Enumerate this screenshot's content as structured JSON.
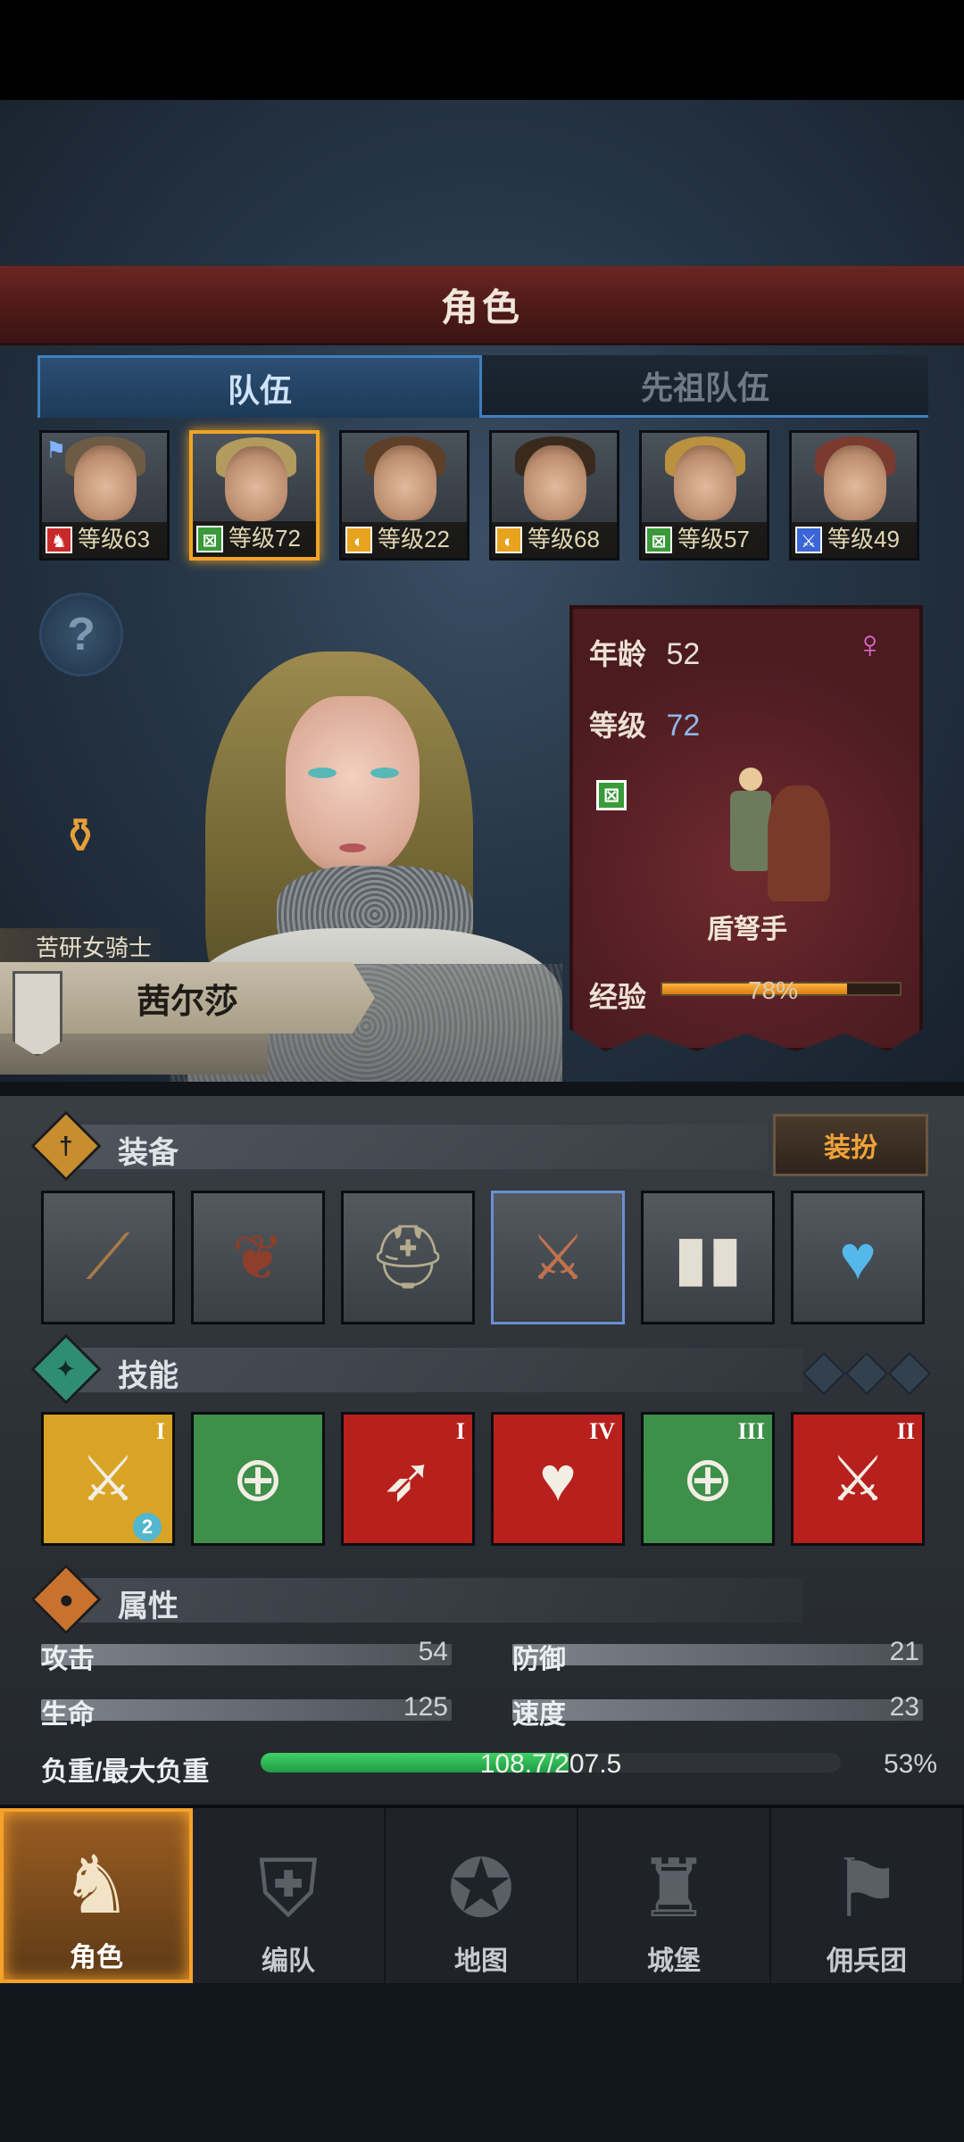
{
  "header": {
    "title": "角色"
  },
  "tabs": [
    {
      "label": "队伍",
      "active": true
    },
    {
      "label": "先祖队伍",
      "active": false
    }
  ],
  "roster": [
    {
      "level_text": "等级63",
      "class_icon": "horse-icon",
      "badge_color": "#c8292b",
      "hair_color": "#6e5b45",
      "flag": true
    },
    {
      "level_text": "等级72",
      "class_icon": "crossbow-icon",
      "badge_color": "#3a9a3a",
      "hair_color": "#b19b5e",
      "selected": true
    },
    {
      "level_text": "等级22",
      "class_icon": "shield-icon",
      "badge_color": "#e8a21e",
      "hair_color": "#5e3f28"
    },
    {
      "level_text": "等级68",
      "class_icon": "shield-icon",
      "badge_color": "#e8a21e",
      "hair_color": "#3a2a1e"
    },
    {
      "level_text": "等级57",
      "class_icon": "crossbow-icon",
      "badge_color": "#3a9a3a",
      "hair_color": "#b9913f"
    },
    {
      "level_text": "等级49",
      "class_icon": "sword-icon",
      "badge_color": "#3a66d6",
      "hair_color": "#7a3a2e"
    }
  ],
  "character": {
    "title": "苦研女骑士",
    "name": "茜尔莎",
    "age_label": "年龄",
    "age": "52",
    "level_label": "等级",
    "level": "72",
    "gender_icon": "female-icon",
    "class_name": "盾弩手",
    "exp_label": "经验",
    "exp_text": "78%",
    "exp_percent": 78
  },
  "equipment": {
    "title": "装备",
    "dress_button": "装扮",
    "slots": [
      {
        "icon": "crossbow-icon",
        "glyph": "⟋"
      },
      {
        "icon": "tree-shield-icon",
        "glyph": "❦"
      },
      {
        "icon": "helmet-icon",
        "glyph": "⛑"
      },
      {
        "icon": "chainmail-armor-icon",
        "glyph": "⚔",
        "selected": true
      },
      {
        "icon": "boots-icon",
        "glyph": "⌐"
      },
      {
        "icon": "heart-amulet-icon",
        "glyph": "♥"
      }
    ]
  },
  "skills": {
    "title": "技能",
    "items": [
      {
        "icon": "sword-cursor-skill-icon",
        "glyph": "⚔",
        "rank": "I",
        "color": "#d9a426",
        "count": "2"
      },
      {
        "icon": "shield-target-skill-icon",
        "glyph": "⊕",
        "rank": "",
        "color": "#3d8f4a"
      },
      {
        "icon": "crossbow-skill-icon",
        "glyph": "➶",
        "rank": "I",
        "color": "#b7201d"
      },
      {
        "icon": "heartbeat-skill-icon",
        "glyph": "♥",
        "rank": "IV",
        "color": "#b7201d"
      },
      {
        "icon": "target-skill-icon",
        "glyph": "⊕",
        "rank": "III",
        "color": "#3d8f4a"
      },
      {
        "icon": "sword-skill-icon",
        "glyph": "⚔",
        "rank": "II",
        "color": "#b7201d"
      }
    ]
  },
  "attributes": {
    "title": "属性",
    "attack_label": "攻击",
    "attack": "54",
    "defense_label": "防御",
    "defense": "21",
    "hp_label": "生命",
    "hp": "125",
    "speed_label": "速度",
    "speed": "23",
    "load_label": "负重/最大负重",
    "load_text": "108.7/207.5",
    "load_percent_text": "53%",
    "load_percent": 53
  },
  "nav": [
    {
      "label": "角色",
      "icon": "knight-icon",
      "glyph": "♞",
      "active": true
    },
    {
      "label": "编队",
      "icon": "helmet-formation-icon",
      "glyph": "⛨"
    },
    {
      "label": "地图",
      "icon": "compass-map-icon",
      "glyph": "✪"
    },
    {
      "label": "城堡",
      "icon": "castle-icon",
      "glyph": "♜"
    },
    {
      "label": "佣兵团",
      "icon": "mercenary-banner-icon",
      "glyph": "⚑"
    }
  ],
  "colors": {
    "accent_orange": "#f0a325",
    "tab_blue": "#3f7fbd",
    "card_red": "#5c2127",
    "load_green": "#2fb554",
    "exp_orange": "#f0a030"
  }
}
